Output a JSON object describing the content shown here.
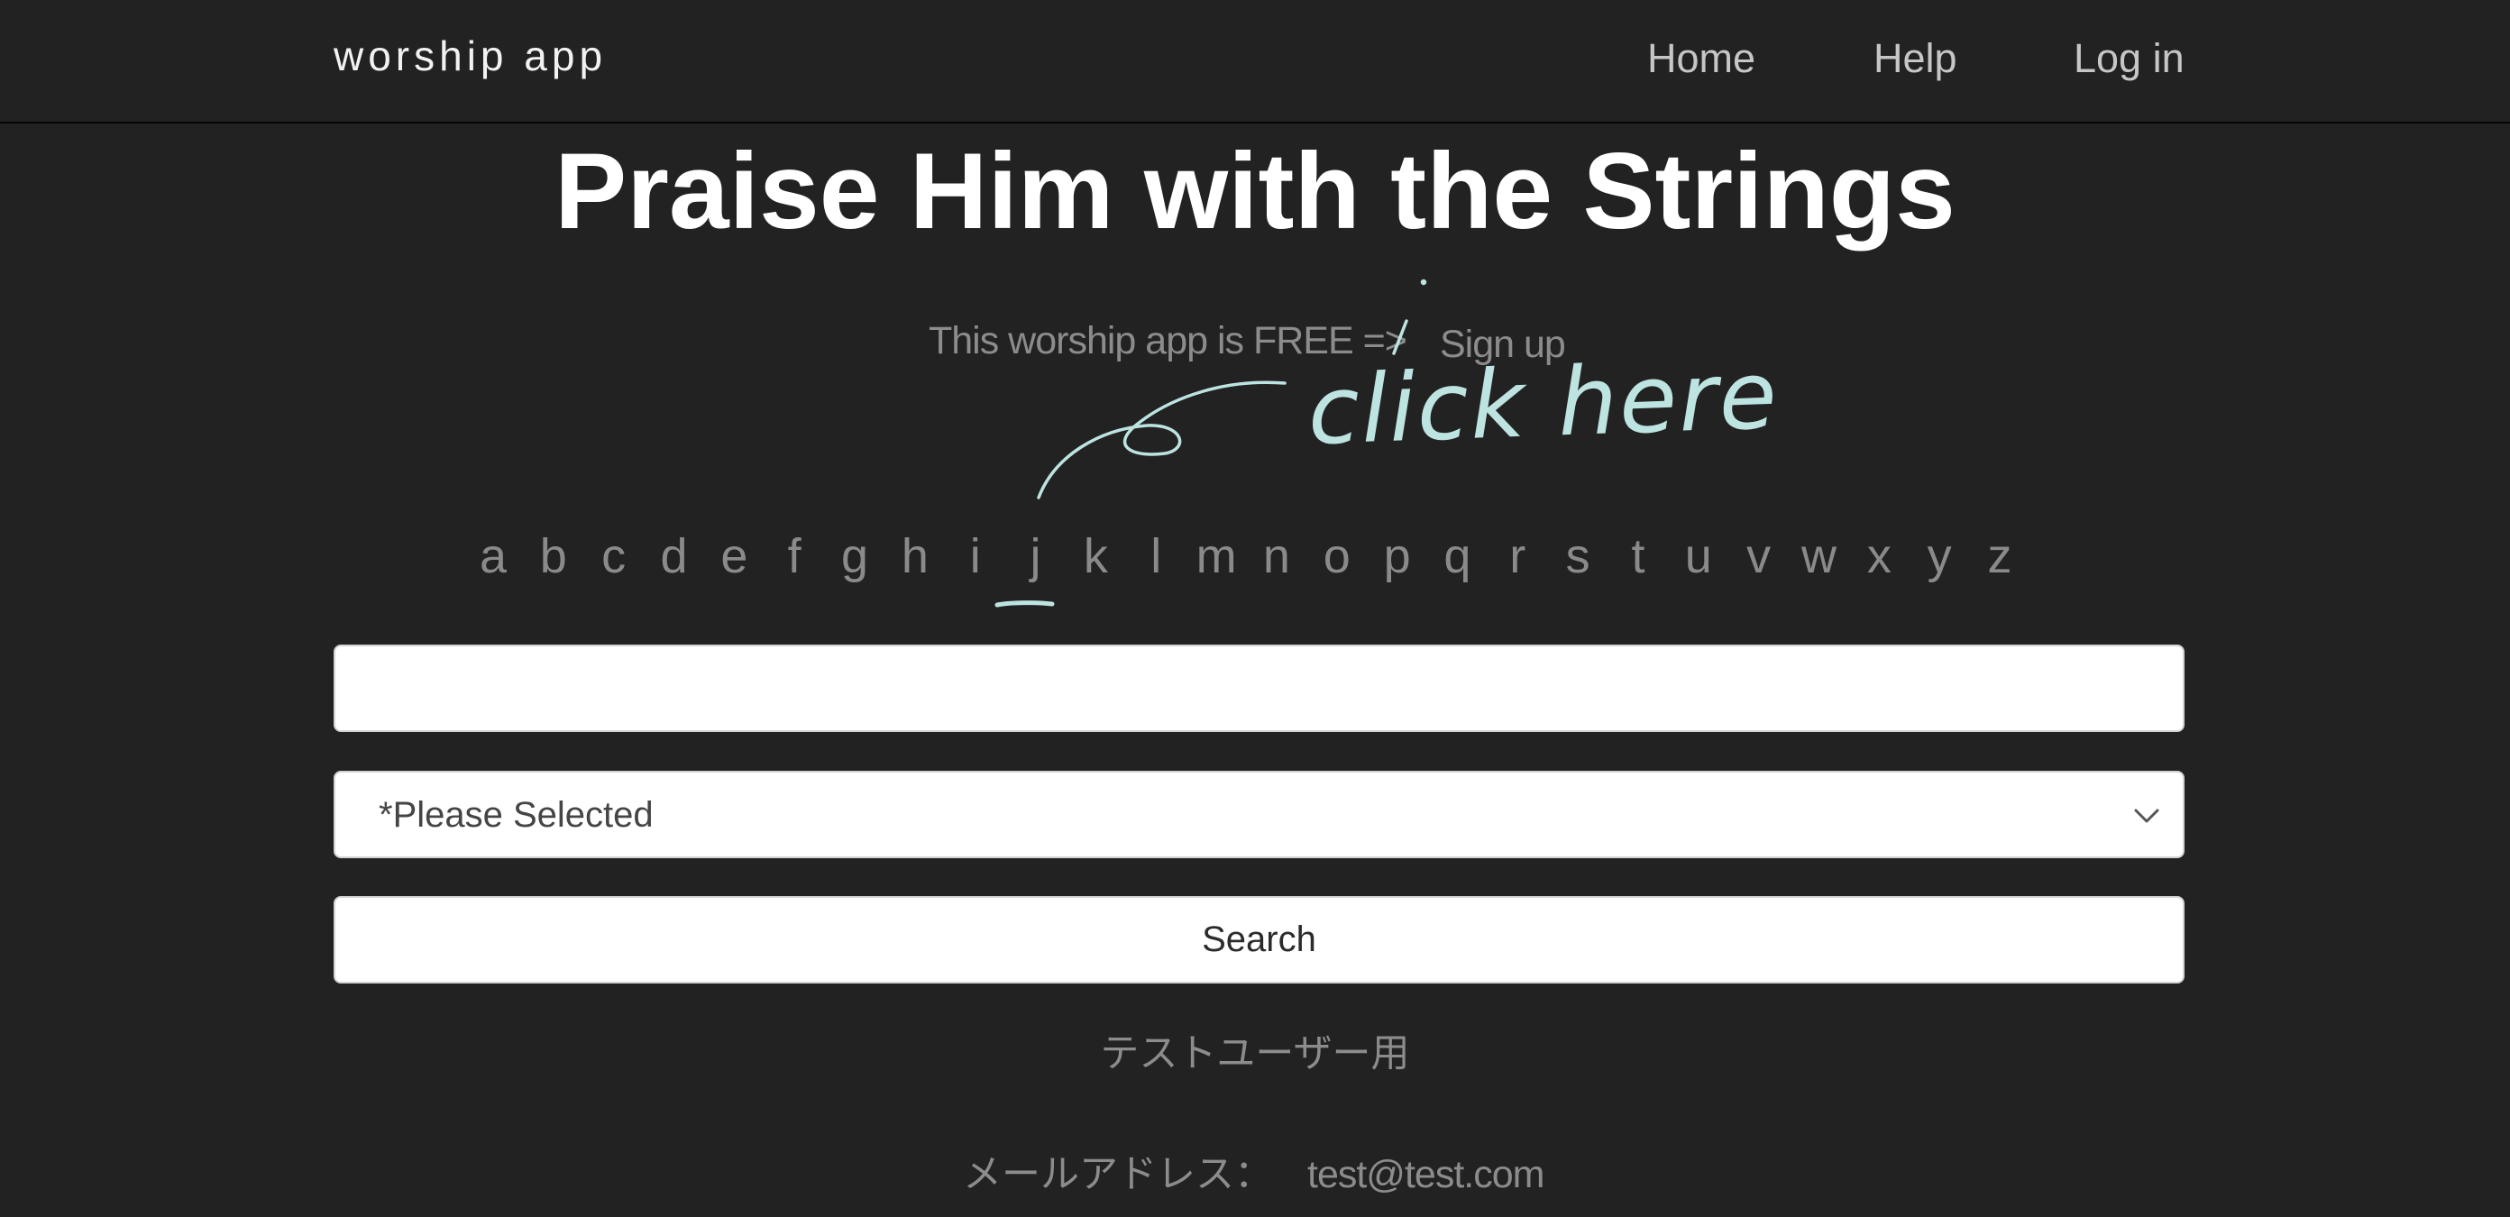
{
  "navbar": {
    "brand": "worship app",
    "links": {
      "home": "Home",
      "help": "Help",
      "login": "Log in"
    }
  },
  "main": {
    "title": "Praise Him with the Strings",
    "free_text": "This worship app is FREE =>",
    "signup_link": "Sign up",
    "annotation_text": "click here",
    "alphabet": [
      "a",
      "b",
      "c",
      "d",
      "e",
      "f",
      "g",
      "h",
      "i",
      "j",
      "k",
      "l",
      "m",
      "n",
      "o",
      "p",
      "q",
      "r",
      "s",
      "t",
      "u",
      "v",
      "w",
      "x",
      "y",
      "z"
    ],
    "underlined_letter": "j",
    "search_input": {
      "value": "",
      "placeholder": ""
    },
    "select": {
      "selected": "*Please Selected"
    },
    "search_button": "Search",
    "test_user": {
      "heading": "テストユーザー用",
      "email_label": "メールアドレス：",
      "email_value": "test@test.com"
    }
  },
  "colors": {
    "background": "#222222",
    "title": "#ffffff",
    "muted_text": "#8c8c8c",
    "nav_text": "#c6c6c6",
    "annotation": "#bde4e1"
  }
}
